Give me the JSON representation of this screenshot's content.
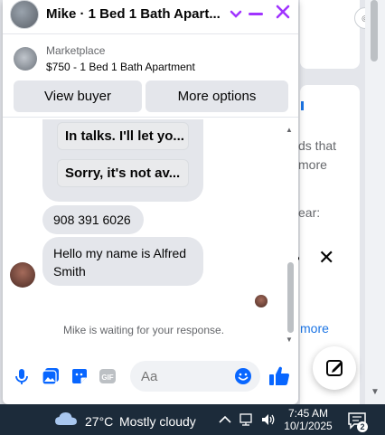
{
  "chat": {
    "title": "Mike · 1 Bed 1 Bath Apart...",
    "accent_color": "#a033ff",
    "listing": {
      "source": "Marketplace",
      "title": "$750 - 1 Bed 1 Bath Apartment"
    },
    "buttons": {
      "view_buyer": "View buyer",
      "more_options": "More options"
    },
    "quick_replies": [
      "In talks. I'll let yo...",
      "Sorry, it's not av..."
    ],
    "messages": [
      {
        "text": "908 391 6026"
      },
      {
        "text": "Hello my name is Alfred Smith"
      }
    ],
    "waiting_status": "Mike is waiting for your response.",
    "composer": {
      "placeholder": "Aa",
      "icons": [
        "microphone-icon",
        "photo-icon",
        "sticker-icon",
        "gif-icon",
        "emoji-icon",
        "like-icon"
      ],
      "gif_label": "GIF"
    }
  },
  "background": {
    "text_fragments": [
      "ds that",
      "more",
      "ear:",
      "more"
    ]
  },
  "taskbar": {
    "weather_temp": "27°C",
    "weather_desc": "Mostly cloudy",
    "time": "7:45 AM",
    "date": "10/1/2025",
    "notification_count": "2",
    "bg_color": "#1c2b3a"
  }
}
